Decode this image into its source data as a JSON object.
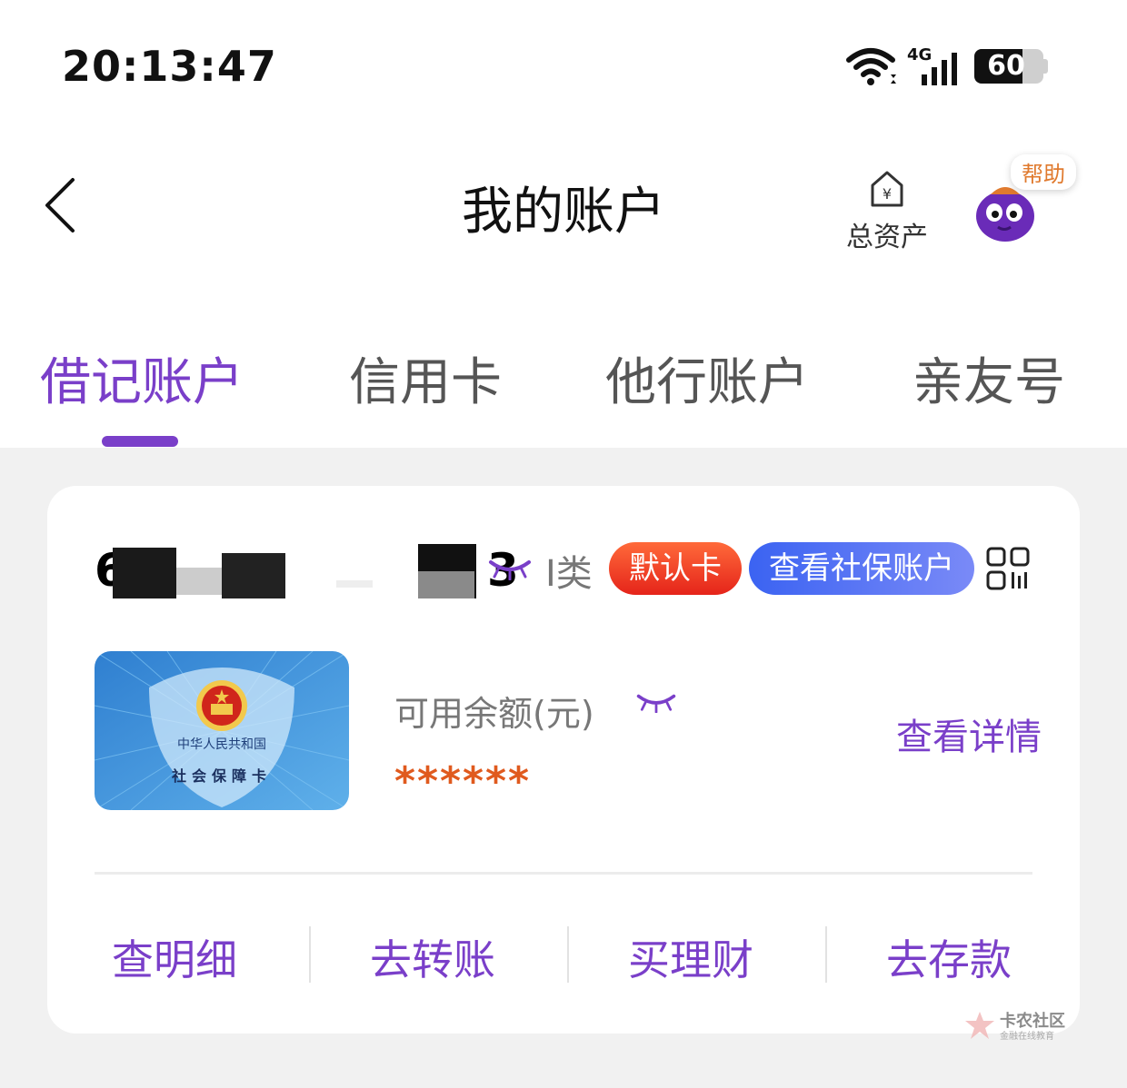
{
  "status_bar": {
    "time": "20:13:47",
    "network": "4G",
    "battery": "60"
  },
  "header": {
    "title": "我的账户",
    "total_assets_label": "总资产",
    "help_label": "帮助"
  },
  "tabs": [
    {
      "label": "借记账户",
      "active": true
    },
    {
      "label": "信用卡",
      "active": false
    },
    {
      "label": "他行账户",
      "active": false
    },
    {
      "label": "亲友号",
      "active": false
    }
  ],
  "account": {
    "number_visible_start": "6",
    "number_visible_end": "3",
    "class_label": "I类",
    "default_badge": "默认卡",
    "social_badge": "查看社保账户",
    "card_image": {
      "line1": "中华人民共和国",
      "line2": "社会保障卡"
    },
    "balance_label": "可用余额(元)",
    "balance_value": "******",
    "detail_link": "查看详情"
  },
  "actions": [
    "查明细",
    "去转账",
    "买理财",
    "去存款"
  ],
  "watermark": {
    "title": "卡农社区",
    "subtitle": "金融在线教育"
  },
  "colors": {
    "accent": "#7a3fc9",
    "balance": "#e05a1e",
    "default_badge": "#e5241a",
    "social_badge": "#3b63f2"
  },
  "icons": [
    "wifi-icon",
    "signal-icon",
    "battery-icon",
    "back-icon",
    "total-assets-icon",
    "help-mascot-icon",
    "eye-closed-icon",
    "qr-code-icon",
    "national-emblem-icon"
  ]
}
